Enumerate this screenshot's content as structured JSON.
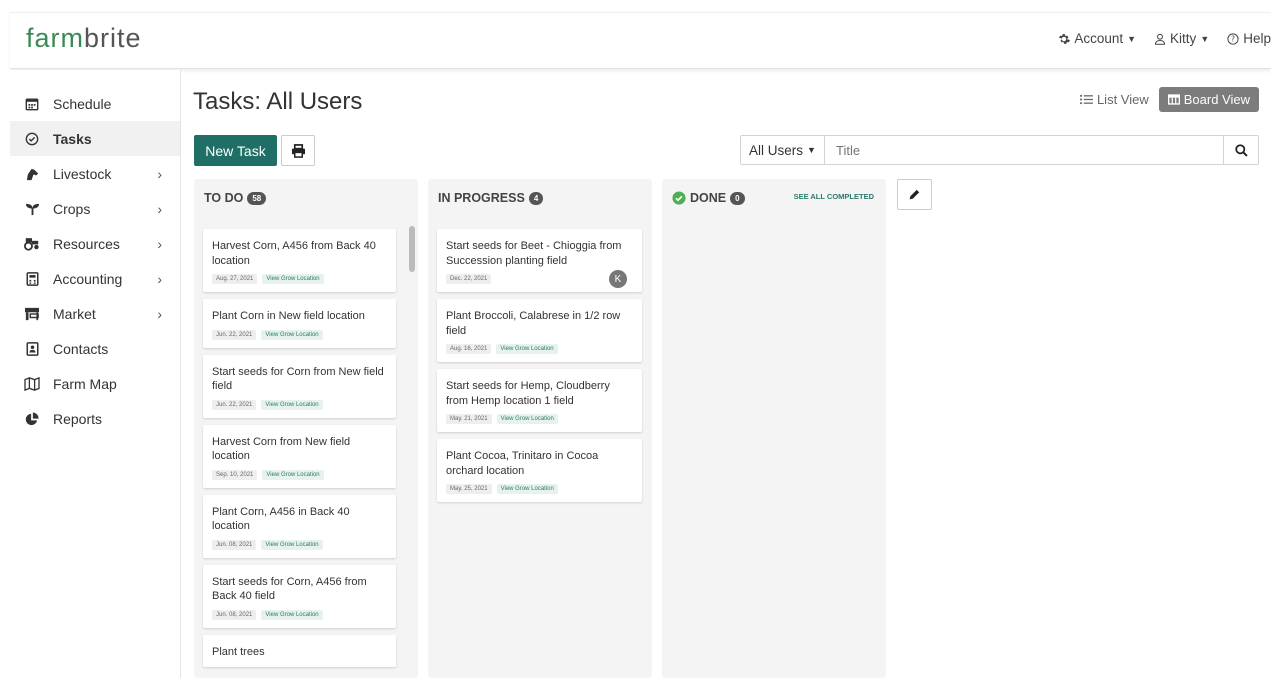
{
  "brand": {
    "logo_green": "farm",
    "logo_gray": "brite",
    "accent": "#1f6f66",
    "logo_color": "#3a8a55"
  },
  "topnav": {
    "account": "Account",
    "user": "Kitty",
    "help": "Help"
  },
  "sidebar": {
    "items": [
      {
        "label": "Schedule",
        "icon": "calendar-icon",
        "chevron": false,
        "active": false
      },
      {
        "label": "Tasks",
        "icon": "check-circle-icon",
        "chevron": false,
        "active": true
      },
      {
        "label": "Livestock",
        "icon": "horse-icon",
        "chevron": true,
        "active": false
      },
      {
        "label": "Crops",
        "icon": "seedling-icon",
        "chevron": true,
        "active": false
      },
      {
        "label": "Resources",
        "icon": "tractor-icon",
        "chevron": true,
        "active": false
      },
      {
        "label": "Accounting",
        "icon": "calculator-icon",
        "chevron": true,
        "active": false
      },
      {
        "label": "Market",
        "icon": "store-icon",
        "chevron": true,
        "active": false
      },
      {
        "label": "Contacts",
        "icon": "contact-card-icon",
        "chevron": false,
        "active": false
      },
      {
        "label": "Farm Map",
        "icon": "map-icon",
        "chevron": false,
        "active": false
      },
      {
        "label": "Reports",
        "icon": "pie-chart-icon",
        "chevron": false,
        "active": false
      }
    ]
  },
  "main": {
    "title": "Tasks: All Users",
    "list_view": "List View",
    "board_view": "Board View",
    "new_task": "New Task",
    "user_filter": "All Users",
    "search_placeholder": "Title"
  },
  "columns": {
    "todo": {
      "title": "TO DO",
      "count": "58",
      "cards": [
        {
          "title": "Harvest Corn, A456 from Back 40 location",
          "date": "Aug. 27, 2021",
          "link": "View Grow Location"
        },
        {
          "title": "Plant Corn in New field location",
          "date": "Jun. 22, 2021",
          "link": "View Grow Location"
        },
        {
          "title": "Start seeds for Corn from New field field",
          "date": "Jun. 22, 2021",
          "link": "View Grow Location"
        },
        {
          "title": "Harvest Corn from New field location",
          "date": "Sep. 10, 2021",
          "link": "View Grow Location"
        },
        {
          "title": "Plant Corn, A456 in Back 40 location",
          "date": "Jun. 08, 2021",
          "link": "View Grow Location"
        },
        {
          "title": "Start seeds for Corn, A456 from Back 40 field",
          "date": "Jun. 08, 2021",
          "link": "View Grow Location"
        },
        {
          "title": "Plant trees",
          "date": "",
          "link": ""
        }
      ]
    },
    "in_progress": {
      "title": "IN PROGRESS",
      "count": "4",
      "cards": [
        {
          "title": "Start seeds for Beet - Chioggia from Succession planting field",
          "date": "Dec. 22, 2021",
          "link": "",
          "avatar": "K"
        },
        {
          "title": "Plant Broccoli, Calabrese in 1/2 row field",
          "date": "Aug. 16, 2021",
          "link": "View Grow Location"
        },
        {
          "title": "Start seeds for Hemp, Cloudberry from Hemp location 1 field",
          "date": "May. 21, 2021",
          "link": "View Grow Location"
        },
        {
          "title": "Plant Cocoa, Trinitaro in Cocoa orchard location",
          "date": "May. 25, 2021",
          "link": "View Grow Location"
        }
      ]
    },
    "done": {
      "title": "DONE",
      "count": "0",
      "see_all": "SEE ALL COMPLETED",
      "status_color": "#4caf50"
    }
  }
}
